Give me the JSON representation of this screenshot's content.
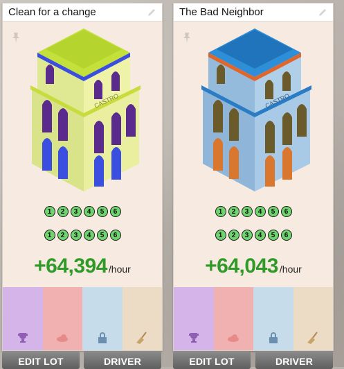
{
  "cards": [
    {
      "title": "Clean for a change",
      "row1": [
        "1",
        "2",
        "3",
        "4",
        "5",
        "6"
      ],
      "row2": [
        "1",
        "2",
        "3",
        "4",
        "5",
        "6"
      ],
      "income_value": "+64,394",
      "income_unit": "/hour",
      "building_colors": {
        "roof": "#c6e33a",
        "wall": "#e6ec9a",
        "accent": "#3b4de0",
        "trim": "#a9c92a"
      },
      "edit_label": "EDIT LOT",
      "driver_label": "DRIVER"
    },
    {
      "title": "The Bad Neighbor",
      "row1": [
        "1",
        "2",
        "3",
        "4",
        "5",
        "6"
      ],
      "row2": [
        "1",
        "2",
        "3",
        "4",
        "5",
        "6"
      ],
      "income_value": "+64,043",
      "income_unit": "/hour",
      "building_colors": {
        "roof": "#2e8fd8",
        "wall": "#9cc3e3",
        "accent": "#e0662b",
        "trim": "#1e6fb3"
      },
      "edit_label": "EDIT LOT",
      "driver_label": "DRIVER"
    }
  ],
  "slot_colors": {
    "purple": "#d5b4e9",
    "pink": "#f2b1b1",
    "blue": "#c7dcea",
    "tan": "#ecdcc5"
  },
  "slot_icons": [
    "trophy-icon",
    "cloud-icon",
    "lock-icon",
    "broom-icon"
  ],
  "building_sign": "CASTRO"
}
